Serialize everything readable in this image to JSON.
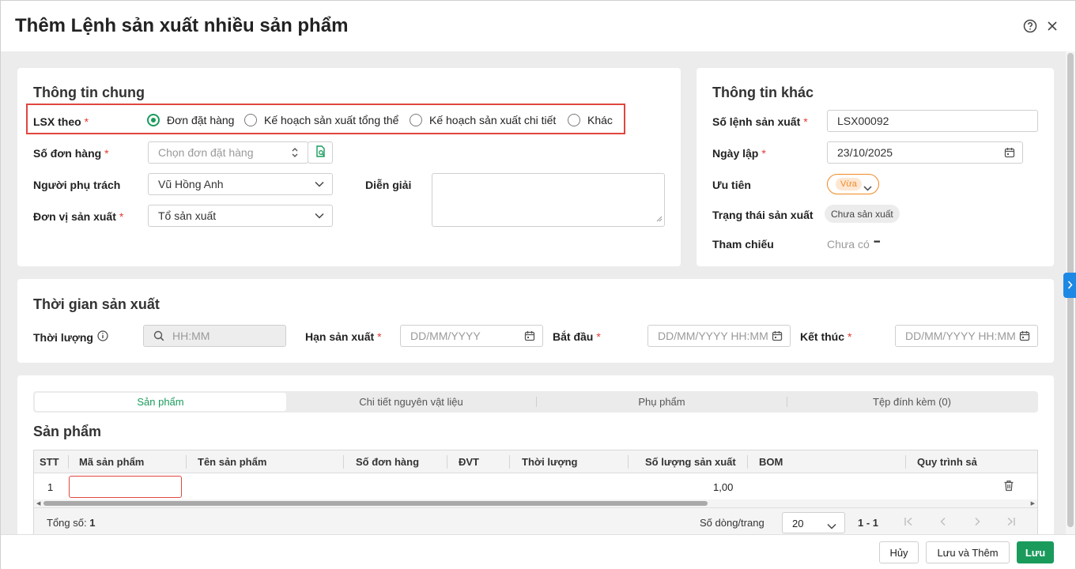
{
  "dialog": {
    "title": "Thêm Lệnh sản xuất nhiều sản phẩm"
  },
  "general": {
    "title": "Thông tin chung",
    "lsx_label": "LSX theo",
    "lsx_options": [
      "Đơn đặt hàng",
      "Kế hoạch sản xuất tổng thể",
      "Kế hoạch sản xuất chi tiết",
      "Khác"
    ],
    "order_label": "Số đơn hàng",
    "order_placeholder": "Chọn đơn đặt hàng",
    "owner_label": "Người phụ trách",
    "owner_value": "Vũ Hồng Anh",
    "unit_label": "Đơn vị sản xuất",
    "unit_value": "Tổ sản xuất",
    "desc_label": "Diễn giải",
    "required_mark": "*"
  },
  "other": {
    "title": "Thông tin khác",
    "no_label": "Số lệnh sản xuất",
    "no_value": "LSX00092",
    "date_label": "Ngày lập",
    "date_value": "23/10/2025",
    "priority_label": "Ưu tiên",
    "priority_value": "Vừa",
    "status_label": "Trạng thái sản xuất",
    "status_value": "Chưa sản xuất",
    "ref_label": "Tham chiếu",
    "ref_value": "Chưa có",
    "ref_more": "•••"
  },
  "time": {
    "title": "Thời gian sản xuất",
    "duration_label": "Thời lượng",
    "duration_placeholder": "HH:MM",
    "deadline_label": "Hạn sản xuất",
    "deadline_placeholder": "DD/MM/YYYY",
    "start_label": "Bắt đầu",
    "start_placeholder": "DD/MM/YYYY HH:MM",
    "end_label": "Kết thúc",
    "end_placeholder": "DD/MM/YYYY HH:MM"
  },
  "tabs": [
    "Sản phẩm",
    "Chi tiết nguyên vật liệu",
    "Phụ phẩm",
    "Tệp đính kèm (0)"
  ],
  "products": {
    "title": "Sản phẩm",
    "columns": [
      "STT",
      "Mã sản phẩm",
      "Tên sản phẩm",
      "Số đơn hàng",
      "ĐVT",
      "Thời lượng",
      "Số lượng sản xuất",
      "BOM",
      "Quy trình sả"
    ],
    "rows": [
      {
        "stt": "1",
        "qty": "1,00"
      }
    ],
    "total_label": "Tổng số:",
    "total_value": "1",
    "page_size_label": "Số dòng/trang",
    "page_size": "20",
    "range": "1 - 1"
  },
  "footer": {
    "cancel": "Hủy",
    "save_add": "Lưu và Thêm",
    "save": "Lưu"
  },
  "colors": {
    "accent": "#1a9b5c",
    "highlight": "#e0463f",
    "priority": "#f08a24"
  }
}
